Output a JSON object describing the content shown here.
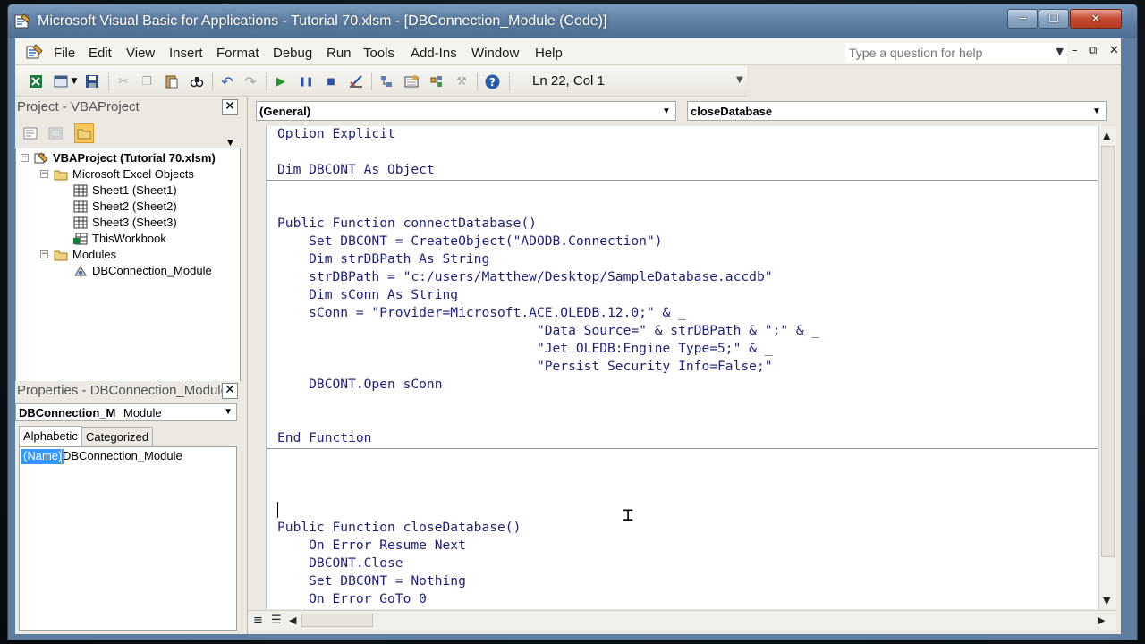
{
  "window": {
    "title": "Microsoft Visual Basic for Applications - Tutorial 70.xlsm - [DBConnection_Module (Code)]"
  },
  "menu": {
    "items": [
      "File",
      "Edit",
      "View",
      "Insert",
      "Format",
      "Debug",
      "Run",
      "Tools",
      "Add-Ins",
      "Window",
      "Help"
    ],
    "help_placeholder": "Type a question for help"
  },
  "toolbar": {
    "status": "Ln 22, Col 1"
  },
  "project": {
    "title": "Project - VBAProject",
    "tree": [
      {
        "label": "VBAProject (Tutorial 70.xlsm)",
        "icon": "vbaproject-icon"
      },
      {
        "label": "Microsoft Excel Objects",
        "icon": "folder-icon"
      },
      {
        "label": "Sheet1 (Sheet1)",
        "icon": "sheet-icon"
      },
      {
        "label": "Sheet2 (Sheet2)",
        "icon": "sheet-icon"
      },
      {
        "label": "Sheet3 (Sheet3)",
        "icon": "sheet-icon"
      },
      {
        "label": "ThisWorkbook",
        "icon": "workbook-icon"
      },
      {
        "label": "Modules",
        "icon": "folder-icon"
      },
      {
        "label": "DBConnection_Module",
        "icon": "module-icon"
      }
    ]
  },
  "properties": {
    "title": "Properties - DBConnection_Module",
    "object_name": "DBConnection_Module",
    "object_type": "Module",
    "tabs": [
      "Alphabetic",
      "Categorized"
    ],
    "rows": [
      {
        "key": "(Name)",
        "value": "DBConnection_Module"
      }
    ]
  },
  "code": {
    "object_combo": "(General)",
    "procedure_combo": "closeDatabase",
    "lines": [
      "Option Explicit",
      "",
      "Dim DBCONT As Object",
      "",
      "",
      "Public Function connectDatabase()",
      "    Set DBCONT = CreateObject(\"ADODB.Connection\")",
      "    Dim strDBPath As String",
      "    strDBPath = \"c:/users/Matthew/Desktop/SampleDatabase.accdb\"",
      "    Dim sConn As String",
      "    sConn = \"Provider=Microsoft.ACE.OLEDB.12.0;\" & _",
      "                                 \"Data Source=\" & strDBPath & \";\" & _",
      "                                 \"Jet OLEDB:Engine Type=5;\" & _",
      "                                 \"Persist Security Info=False;\"",
      "    DBCONT.Open sConn",
      "",
      "",
      "End Function",
      "",
      "",
      "",
      "",
      "Public Function closeDatabase()",
      "    On Error Resume Next",
      "    DBCONT.Close",
      "    Set DBCONT = Nothing",
      "    On Error GoTo 0"
    ]
  }
}
